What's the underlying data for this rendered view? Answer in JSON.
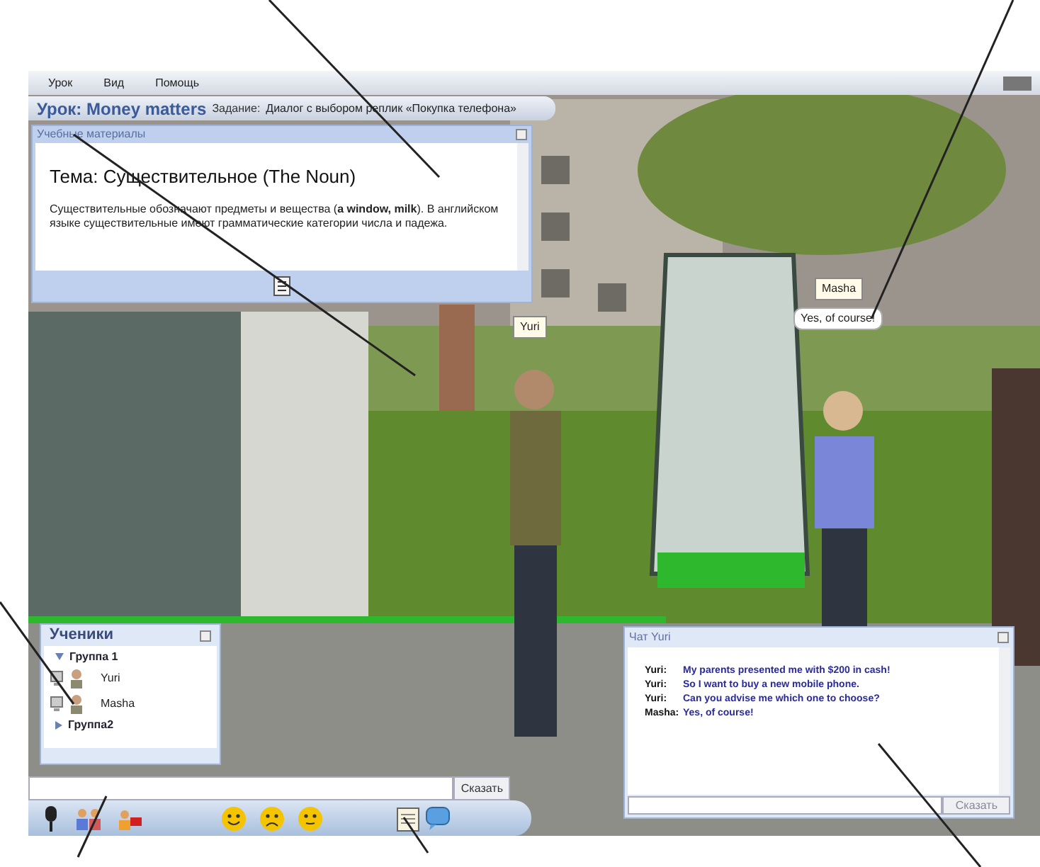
{
  "menu": [
    "Урок",
    "Вид",
    "Помощь"
  ],
  "lesson": {
    "title": "Урок: Money matters",
    "task_label": "Задание:",
    "task": "Диалог с выбором реплик «Покупка телефона»"
  },
  "materials": {
    "title": "Учебные материалы",
    "heading": "Тема: Существительное (The Noun)",
    "body": "Существительные обозначают предметы и вещества (**a window, milk**). В английском языке существительные имеют грамматические категории числа и падежа."
  },
  "scene_labels": [
    {
      "kind": "name",
      "text": "Yuri"
    },
    {
      "kind": "name",
      "text": "Masha"
    },
    {
      "kind": "speech",
      "text": "Yes, of course!"
    }
  ],
  "students": {
    "title": "Ученики",
    "groups": [
      {
        "name": "Группа 1",
        "expanded": true,
        "children": [
          {
            "name": "Yuri"
          },
          {
            "name": "Masha"
          }
        ]
      },
      {
        "name": "Группа2",
        "expanded": false
      }
    ]
  },
  "say_bar": {
    "button": "Сказать"
  },
  "chat": {
    "title": "Чат Yuri",
    "messages": [
      {
        "speaker": "Yuri:",
        "text": "My parents presented me with $200 in cash!"
      },
      {
        "speaker": "Yuri:",
        "text": "So I want to buy a new mobile phone."
      },
      {
        "speaker": "Yuri:",
        "text": "Can you advise  me which one to choose?"
      },
      {
        "speaker": "Masha:",
        "text": "Yes, of course!"
      }
    ],
    "button": "Сказать"
  }
}
